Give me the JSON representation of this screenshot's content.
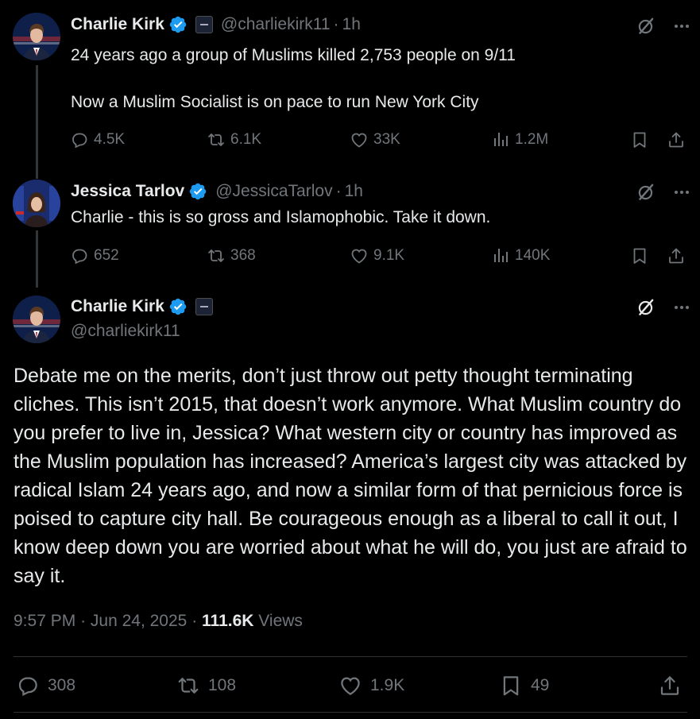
{
  "tweet1": {
    "name": "Charlie Kirk",
    "handle": "@charliekirk11",
    "sep": "·",
    "time": "1h",
    "line1": "24 years ago a group of Muslims killed 2,753 people on 9/11",
    "line2": "Now a Muslim Socialist is on pace to run New York City",
    "replies": "4.5K",
    "reposts": "6.1K",
    "likes": "33K",
    "views": "1.2M"
  },
  "tweet2": {
    "name": "Jessica Tarlov",
    "handle": "@JessicaTarlov",
    "sep": "·",
    "time": "1h",
    "text": "Charlie - this is so gross and Islamophobic. Take it down.",
    "replies": "652",
    "reposts": "368",
    "likes": "9.1K",
    "views": "140K"
  },
  "main": {
    "name": "Charlie Kirk",
    "handle": "@charliekirk11",
    "text": "Debate me on the merits, don’t just throw out petty thought terminating cliches. This isn’t 2015, that doesn’t work anymore. What Muslim country do you prefer to live in, Jessica? What western city or country has improved as the Muslim population has increased? America’s largest city was attacked by radical Islam 24 years ago, and now a similar form of that pernicious force is poised to capture city hall. Be courageous enough as a liberal to call it out, I know deep down you are worried about what he will do, you just are afraid to say it.",
    "time": "9:57 PM",
    "sep": "·",
    "date": "Jun 24, 2025",
    "views_count": "111.6K",
    "views_label": "Views",
    "replies": "308",
    "reposts": "108",
    "likes": "1.9K",
    "bookmarks": "49"
  },
  "colors": {
    "background": "#000000",
    "text": "#e7e9ea",
    "muted": "#71767b",
    "verified": "#1d9bf0",
    "divider": "#2f3336"
  },
  "icons": [
    "verified-badge-icon",
    "affiliate-badge-icon",
    "grok-icon",
    "more-icon",
    "reply-icon",
    "repost-icon",
    "like-icon",
    "views-icon",
    "bookmark-icon",
    "share-icon"
  ]
}
